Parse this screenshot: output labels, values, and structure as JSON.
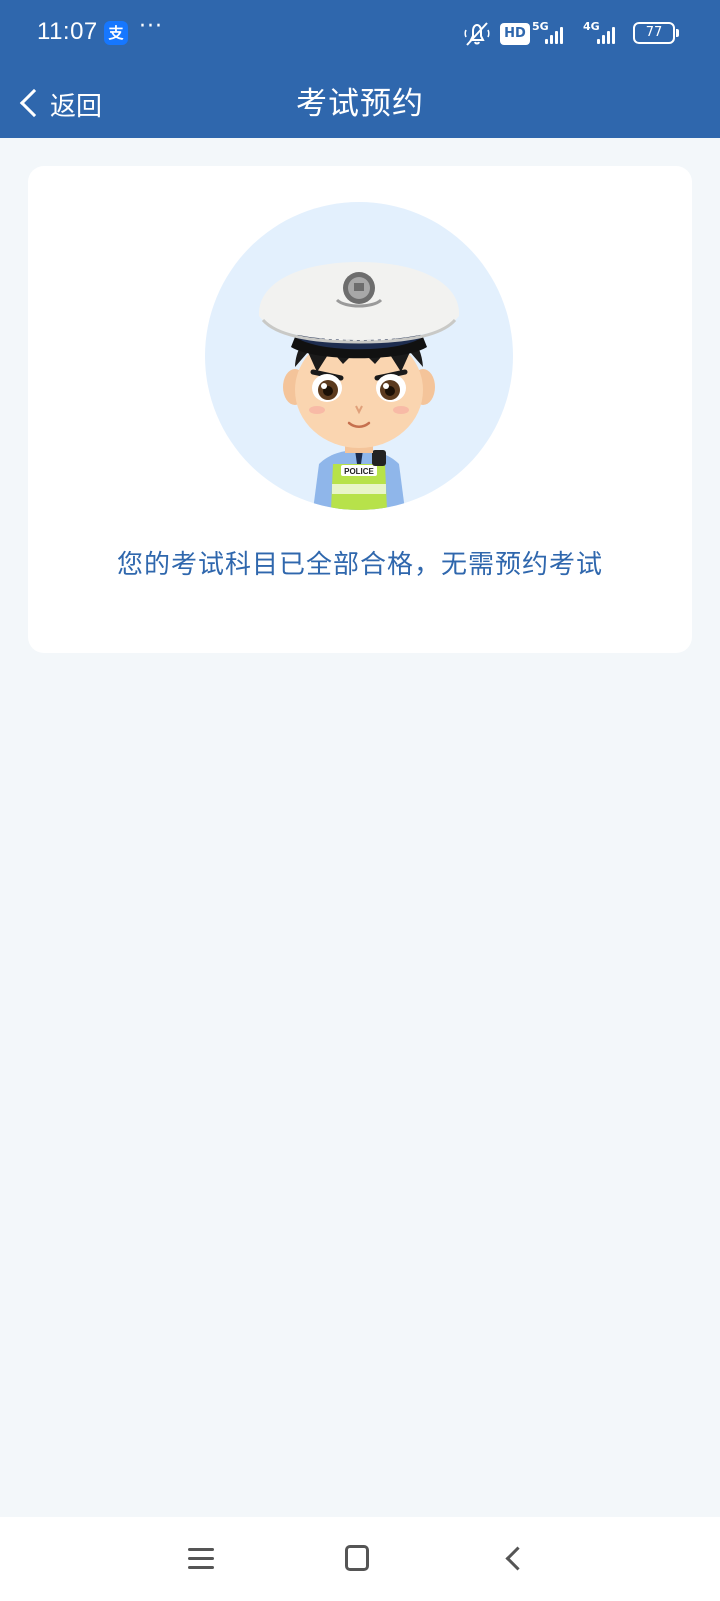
{
  "status_bar": {
    "time": "11:07",
    "app_badge": "支",
    "more": "···",
    "hd_label": "HD",
    "network_5g": "5G",
    "network_4g": "4G",
    "battery_level": "77"
  },
  "header": {
    "back_label": "返回",
    "title": "考试预约"
  },
  "card": {
    "avatar_badge_text": "POLICE",
    "message": "您的考试科目已全部合格，无需预约考试"
  },
  "colors": {
    "primary": "#2f67ad",
    "background": "#f3f7fa",
    "avatar_bg": "#e3f0fd"
  },
  "icons": {
    "back": "chevron-left-icon",
    "menu": "menu-icon",
    "home": "home-icon",
    "nav_back": "back-icon"
  }
}
